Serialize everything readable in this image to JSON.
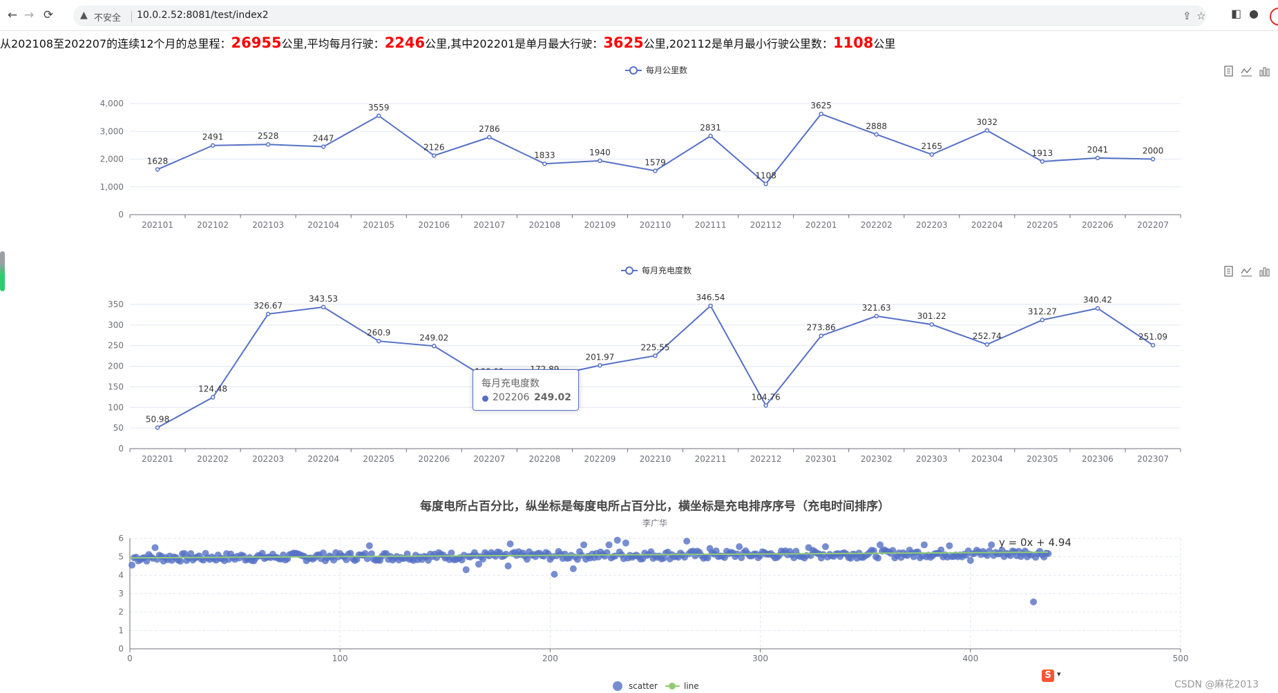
{
  "browser": {
    "nav_back": "←",
    "nav_forward": "→",
    "reload": "⟳",
    "warn_icon": "▲",
    "not_secure": "不安全",
    "url": "10.0.2.52:8081/test/index2"
  },
  "summary": {
    "p1": "从202108至202207的连续12个月的总里程：",
    "total": "26955",
    "p2": "公里,平均每月行驶：",
    "avg": "2246",
    "p3": "公里,其中202201是单月最大行驶：",
    "max": "3625",
    "p4": "公里,202112是单月最小行驶公里数：",
    "min": "1108",
    "p5": "公里"
  },
  "chart_data": [
    {
      "type": "line",
      "legend": [
        "每月公里数"
      ],
      "color": "#5470c6",
      "categories": [
        "202101",
        "202102",
        "202103",
        "202104",
        "202105",
        "202106",
        "202107",
        "202108",
        "202109",
        "202110",
        "202111",
        "202112",
        "202201",
        "202202",
        "202203",
        "202204",
        "202205",
        "202206",
        "202207"
      ],
      "series": [
        {
          "name": "每月公里数",
          "values": [
            1628,
            2491,
            2528,
            2447,
            3559,
            2126,
            2786,
            1833,
            1940,
            1579,
            2831,
            1108,
            3625,
            2888,
            2165,
            3032,
            1913,
            2041,
            2000
          ]
        }
      ],
      "yticks": [
        "0",
        "1,000",
        "2,000",
        "3,000",
        "4,000"
      ],
      "ylim": [
        0,
        4000
      ]
    },
    {
      "type": "line",
      "legend": [
        "每月充电度数"
      ],
      "color": "#5470c6",
      "categories": [
        "202201",
        "202202",
        "202203",
        "202204",
        "202205",
        "202206",
        "202207",
        "202208",
        "202209",
        "202210",
        "202211",
        "202212",
        "202301",
        "202302",
        "202303",
        "202304",
        "202305",
        "202306",
        "202307"
      ],
      "series": [
        {
          "name": "每月充电度数",
          "values": [
            50.98,
            124.48,
            326.67,
            343.53,
            260.9,
            249.02,
            166.69,
            172.89,
            201.97,
            225.55,
            346.54,
            104.76,
            273.86,
            321.63,
            301.22,
            252.74,
            312.27,
            340.42,
            251.09
          ]
        }
      ],
      "labels": [
        "50.98",
        "124.48",
        "326.67",
        "343.53",
        "260.9",
        "249.02",
        "166.69",
        "172.89",
        "201.97",
        "225.55",
        "346.54",
        "104.76",
        "273.86",
        "321.63",
        "301.22",
        "252.74",
        "312.27",
        "340.42",
        "251.09"
      ],
      "yticks": [
        "0",
        "50",
        "100",
        "150",
        "200",
        "250",
        "300",
        "350"
      ],
      "ylim": [
        0,
        350
      ],
      "tooltip": {
        "title": "每月充电度数",
        "name": "202206",
        "value": "249.02"
      }
    },
    {
      "type": "scatter",
      "title": "每度电所占百分比，纵坐标是每度电所占百分比，横坐标是充电排序序号（充电时间排序）",
      "subtitle": "李广华",
      "xlim": [
        0,
        500
      ],
      "ylim": [
        0,
        6
      ],
      "xticks": [
        "0",
        "100",
        "200",
        "300",
        "400",
        "500"
      ],
      "yticks": [
        "0",
        "1",
        "2",
        "3",
        "4",
        "5",
        "6"
      ],
      "scatter_color": "#5470c6",
      "line_color": "#91cc75",
      "series": [
        {
          "name": "scatter",
          "n": 437,
          "typical_range": [
            4.7,
            5.3
          ],
          "notable_points": [
            [
              1,
              4.55
            ],
            [
              12,
              5.5
            ],
            [
              114,
              5.6
            ],
            [
              160,
              4.3
            ],
            [
              166,
              4.6
            ],
            [
              180,
              4.5
            ],
            [
              181,
              5.7
            ],
            [
              202,
              4.05
            ],
            [
              211,
              4.35
            ],
            [
              216,
              5.65
            ],
            [
              228,
              5.65
            ],
            [
              232,
              5.9
            ],
            [
              236,
              5.75
            ],
            [
              265,
              5.85
            ],
            [
              276,
              5.45
            ],
            [
              290,
              5.55
            ],
            [
              323,
              5.5
            ],
            [
              331,
              5.55
            ],
            [
              357,
              5.65
            ],
            [
              378,
              5.65
            ],
            [
              390,
              5.6
            ],
            [
              400,
              4.8
            ],
            [
              410,
              5.65
            ],
            [
              430,
              2.55
            ]
          ]
        },
        {
          "name": "line",
          "x": [
            0,
            437
          ],
          "y": [
            4.94,
            5.25
          ]
        }
      ],
      "equation": "y = 0x + 4.94",
      "legend": [
        "scatter",
        "line"
      ]
    }
  ],
  "toolbox": [
    "data-view-icon",
    "line-switch-icon",
    "bar-switch-icon"
  ],
  "watermark": "CSDN @麻花2013"
}
